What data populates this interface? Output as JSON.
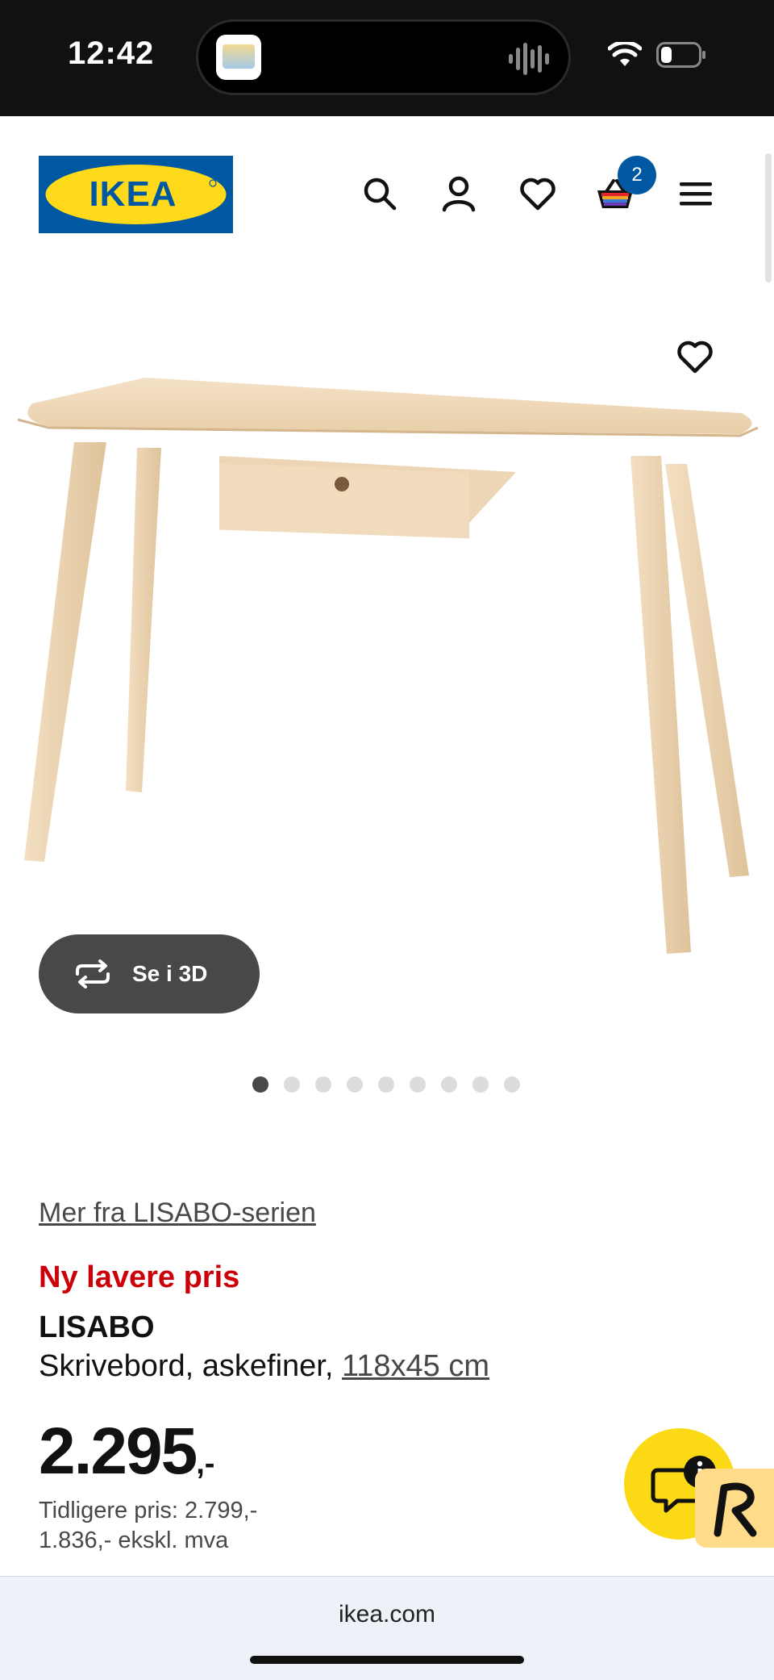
{
  "status_bar": {
    "time": "12:42"
  },
  "header": {
    "logo_text": "IKEA",
    "cart_count": "2",
    "brand_colors": {
      "blue": "#0058a3",
      "yellow": "#ffda1a"
    },
    "icons": [
      "search-icon",
      "account-icon",
      "heart-icon",
      "cart-icon",
      "menu-icon"
    ]
  },
  "gallery": {
    "view_3d_label": "Se i 3D",
    "image_count": 9,
    "active_index": 0
  },
  "product": {
    "series_link": "Mer fra LISABO-serien",
    "promo_label": "Ny lavere pris",
    "name": "LISABO",
    "description": "Skrivebord, askefiner,",
    "dimensions": "118x45 cm",
    "price": "2.295",
    "price_suffix": ",-",
    "previous_price": "Tidligere pris: 2.799,-",
    "price_ex_vat": "1.836,- ekskl. mva",
    "promo_color": "#cc0008"
  },
  "browser": {
    "url": "ikea.com"
  }
}
